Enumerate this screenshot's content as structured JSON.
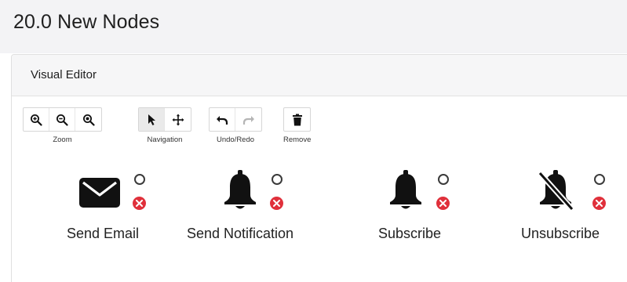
{
  "page": {
    "title": "20.0 New Nodes"
  },
  "editor": {
    "title": "Visual Editor",
    "toolbar": {
      "groups": [
        {
          "label": "Zoom",
          "buttons": [
            "zoom-in-icon",
            "zoom-out-icon",
            "zoom-reset-icon"
          ]
        },
        {
          "label": "Navigation",
          "buttons": [
            "pointer-icon",
            "move-icon"
          ],
          "active": "pointer-icon"
        },
        {
          "label": "Undo/Redo",
          "buttons": [
            "undo-icon",
            "redo-icon"
          ]
        },
        {
          "label": "Remove",
          "buttons": [
            "trash-icon"
          ]
        }
      ]
    },
    "nodes": [
      {
        "label": "Send Email",
        "icon": "envelope-icon"
      },
      {
        "label": "Send Notification",
        "icon": "bell-icon"
      },
      {
        "label": "Subscribe",
        "icon": "bell-icon"
      },
      {
        "label": "Unsubscribe",
        "icon": "bell-slash-icon"
      }
    ]
  },
  "colors": {
    "remove": "#e0303b",
    "icon": "#111111"
  }
}
